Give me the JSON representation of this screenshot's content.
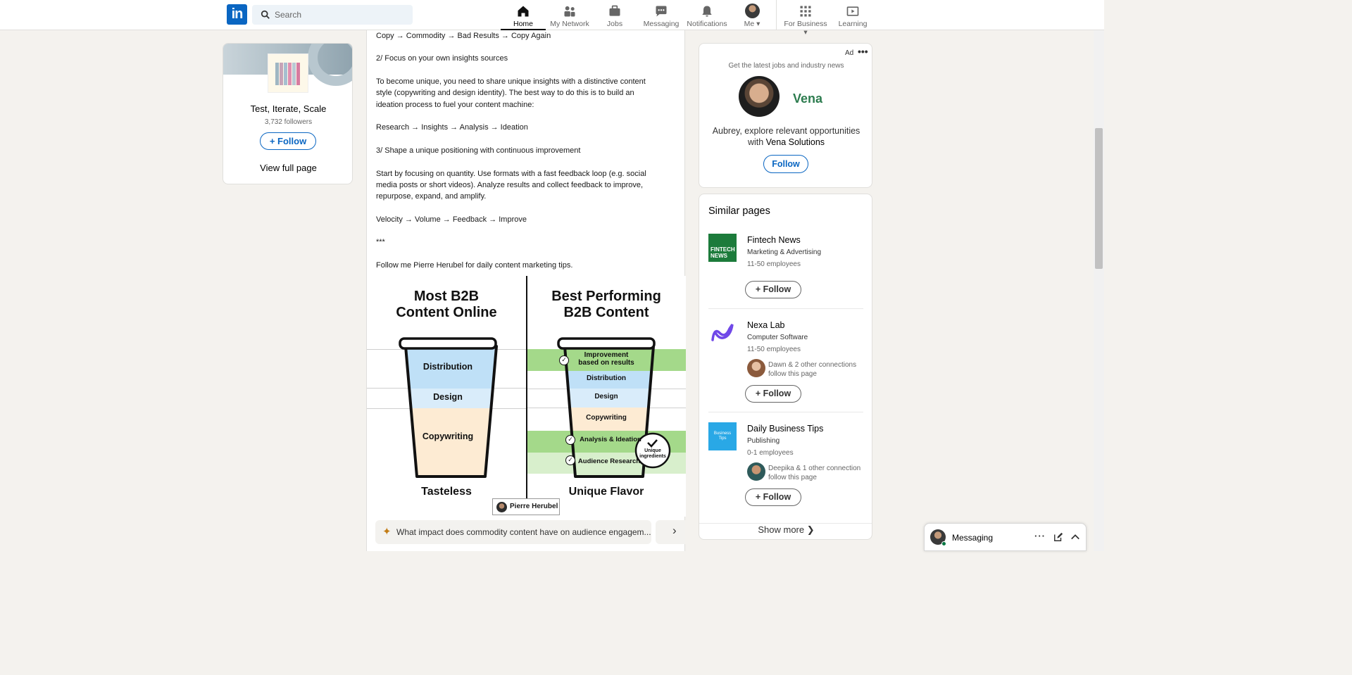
{
  "nav": {
    "logo": "in",
    "search_placeholder": "Search",
    "items": [
      {
        "label": "Home"
      },
      {
        "label": "My Network"
      },
      {
        "label": "Jobs"
      },
      {
        "label": "Messaging"
      },
      {
        "label": "Notifications"
      },
      {
        "label": "Me ▾"
      },
      {
        "label": "For Business ▾"
      },
      {
        "label": "Learning"
      }
    ]
  },
  "left_card": {
    "name": "Test, Iterate, Scale",
    "followers": "3,732 followers",
    "follow_label": "+ Follow",
    "view_label": "View full page"
  },
  "post": {
    "lines": [
      "Copy → Commodity → Bad Results → Copy Again",
      "2/ Focus on your own insights sources",
      "To become unique, you need to share unique insights with a distinctive content",
      "style (copywriting and design identity). The best way to do this is to build an",
      "ideation process to fuel your content machine:",
      "Research → Insights → Analysis → Ideation",
      "3/ Shape a unique positioning with continuous improvement",
      "Start by focusing on quantity. Use formats with a fast feedback loop (e.g. social",
      "media posts or short videos). Analyze results and collect feedback to improve,",
      "repurpose, expand, and amplify.",
      "Velocity → Volume → Feedback → Improve",
      "***",
      "Follow me Pierre Herubel for daily content marketing tips."
    ],
    "infographic": {
      "left_title_1": "Most B2B",
      "left_title_2": "Content Online",
      "right_title_1": "Best Performing",
      "right_title_2": "B2B Content",
      "left_layers": [
        "Distribution",
        "Design",
        "Copywriting"
      ],
      "right_layers": [
        "Improvement",
        "based on results",
        "Distribution",
        "Design",
        "Copywriting",
        "Analysis & Ideation",
        "Audience Research"
      ],
      "badge_1": "Unique",
      "badge_2": "ingredients",
      "left_footer": "Tasteless",
      "right_footer": "Unique Flavor",
      "author": "Pierre Herubel"
    },
    "ai_prompt": "What impact does commodity content have on audience engagem..."
  },
  "ad": {
    "label": "Ad",
    "tagline": "Get the latest jobs and industry news",
    "company_logo": "Vena",
    "text_1": "Aubrey, explore relevant opportunities",
    "text_2": "with",
    "company": "Vena Solutions",
    "follow_label": "Follow"
  },
  "similar": {
    "title": "Similar pages",
    "items": [
      {
        "name": "Fintech News",
        "industry": "Marketing & Advertising",
        "size": "11-50 employees",
        "connections_1": "",
        "connections_2": "",
        "follow_label": "+ Follow",
        "logo_text": "FINTECH NEWS"
      },
      {
        "name": "Nexa Lab",
        "industry": "Computer Software",
        "size": "11-50 employees",
        "connections_1": "Dawn & 2 other connections",
        "connections_2": "follow this page",
        "follow_label": "+ Follow",
        "logo_text": ""
      },
      {
        "name": "Daily Business Tips",
        "industry": "Publishing",
        "size": "0-1 employees",
        "connections_1": "Deepika & 1 other connection",
        "connections_2": "follow this page",
        "follow_label": "+ Follow",
        "logo_text": "Business Tips"
      }
    ],
    "show_more": "Show more ❯"
  },
  "messaging": {
    "label": "Messaging"
  },
  "colors": {
    "brand": "#0a66c2",
    "distribution": "#bfe0f7",
    "design": "#d9ecfa",
    "copywriting": "#fdebd3",
    "green_band": "#a4d98a"
  }
}
